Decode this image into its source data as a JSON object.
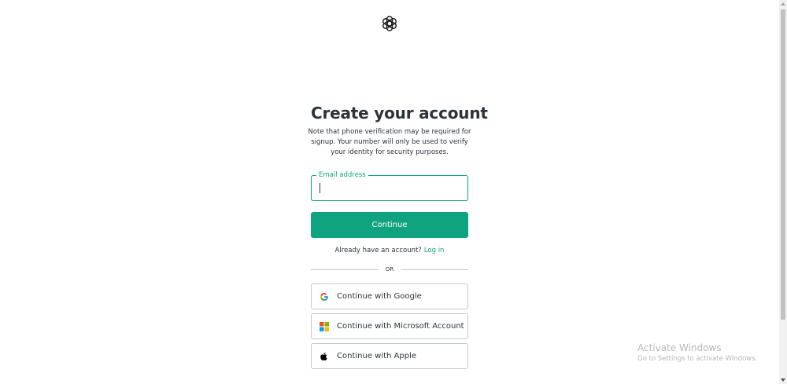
{
  "logo": {
    "icon": "openai-logo-icon"
  },
  "signup": {
    "title": "Create your account",
    "subtitle": "Note that phone verification may be required for signup. Your number will only be used to verify your identity for security purposes.",
    "email": {
      "label": "Email address",
      "value": ""
    },
    "continue_label": "Continue",
    "login_prompt": "Already have an account?",
    "login_link": "Log in",
    "divider_text": "OR",
    "social": [
      {
        "label": "Continue with Google",
        "icon": "google-icon"
      },
      {
        "label": "Continue with Microsoft Account",
        "icon": "microsoft-icon"
      },
      {
        "label": "Continue with Apple",
        "icon": "apple-icon"
      }
    ]
  },
  "watermark": {
    "title": "Activate Windows",
    "subtitle": "Go to Settings to activate Windows."
  },
  "colors": {
    "accent": "#10a37f",
    "text": "#2d333a",
    "border": "#c2c8d0",
    "background": "#ffffff"
  }
}
